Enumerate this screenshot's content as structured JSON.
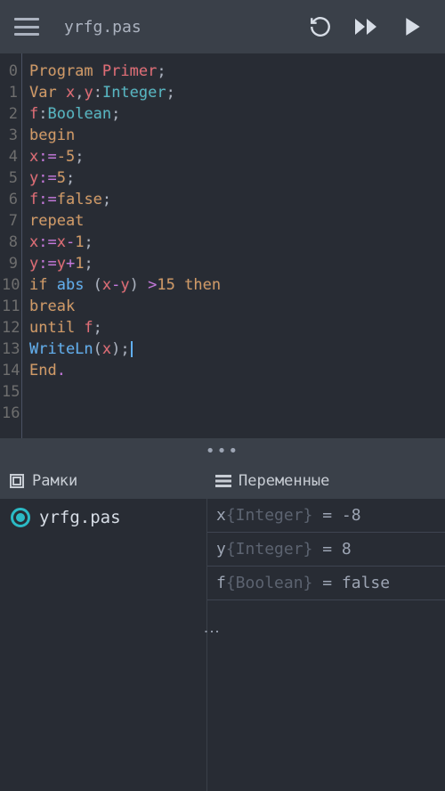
{
  "toolbar": {
    "filename": "yrfg.pas"
  },
  "code": {
    "lines": [
      {
        "n": "0",
        "tokens": [
          [
            "kw",
            "Program "
          ],
          [
            "ident",
            "Primer"
          ],
          [
            "punct",
            ";"
          ]
        ]
      },
      {
        "n": "1",
        "tokens": [
          [
            "kw",
            "Var "
          ],
          [
            "ident",
            "x"
          ],
          [
            "punct",
            ","
          ],
          [
            "ident",
            "y"
          ],
          [
            "punct",
            ":"
          ],
          [
            "type",
            "Integer"
          ],
          [
            "punct",
            ";"
          ]
        ]
      },
      {
        "n": "2",
        "tokens": [
          [
            "ident",
            "f"
          ],
          [
            "punct",
            ":"
          ],
          [
            "type",
            "Boolean"
          ],
          [
            "punct",
            ";"
          ]
        ]
      },
      {
        "n": "3",
        "tokens": [
          [
            "kw",
            "begin"
          ]
        ]
      },
      {
        "n": "4",
        "tokens": [
          [
            "ident",
            "x"
          ],
          [
            "op",
            ":="
          ],
          [
            "num",
            "-5"
          ],
          [
            "punct",
            ";"
          ]
        ]
      },
      {
        "n": "5",
        "tokens": [
          [
            "ident",
            "y"
          ],
          [
            "op",
            ":="
          ],
          [
            "num",
            "5"
          ],
          [
            "punct",
            ";"
          ]
        ]
      },
      {
        "n": "6",
        "tokens": [
          [
            "ident",
            "f"
          ],
          [
            "op",
            ":="
          ],
          [
            "num",
            "false"
          ],
          [
            "punct",
            ";"
          ]
        ]
      },
      {
        "n": "7",
        "tokens": [
          [
            "kw",
            "repeat"
          ]
        ]
      },
      {
        "n": "8",
        "tokens": [
          [
            "ident",
            "x"
          ],
          [
            "op",
            ":="
          ],
          [
            "ident",
            "x"
          ],
          [
            "op",
            "-"
          ],
          [
            "num",
            "1"
          ],
          [
            "punct",
            ";"
          ]
        ]
      },
      {
        "n": "9",
        "tokens": [
          [
            "ident",
            "y"
          ],
          [
            "op",
            ":="
          ],
          [
            "ident",
            "y"
          ],
          [
            "op",
            "+"
          ],
          [
            "num",
            "1"
          ],
          [
            "punct",
            ";"
          ]
        ]
      },
      {
        "n": "10",
        "tokens": [
          [
            "kw",
            "if "
          ],
          [
            "func",
            "abs "
          ],
          [
            "punct",
            "("
          ],
          [
            "ident",
            "x"
          ],
          [
            "op",
            "-"
          ],
          [
            "ident",
            "y"
          ],
          [
            "punct",
            ") "
          ],
          [
            "op",
            ">"
          ],
          [
            "num",
            "15 "
          ],
          [
            "kw",
            "then"
          ]
        ]
      },
      {
        "n": "11",
        "tokens": [
          [
            "kw",
            "break"
          ]
        ]
      },
      {
        "n": "12",
        "tokens": [
          [
            "kw",
            "until "
          ],
          [
            "ident",
            "f"
          ],
          [
            "punct",
            ";"
          ]
        ]
      },
      {
        "n": "13",
        "tokens": [
          [
            "func",
            "WriteLn"
          ],
          [
            "punct",
            "("
          ],
          [
            "ident",
            "x"
          ],
          [
            "punct",
            ");"
          ]
        ],
        "cursor": true
      },
      {
        "n": "14",
        "tokens": [
          [
            "kw",
            "End"
          ],
          [
            "op",
            "."
          ]
        ]
      },
      {
        "n": "15",
        "tokens": []
      },
      {
        "n": "16",
        "tokens": []
      }
    ]
  },
  "panels": {
    "frames_title": "Рамки",
    "vars_title": "Переменные",
    "frame": {
      "name": "yrfg.pas"
    },
    "variables": [
      {
        "name": "x",
        "type": "Integer",
        "value": "-8"
      },
      {
        "name": "y",
        "type": "Integer",
        "value": "8"
      },
      {
        "name": "f",
        "type": "Boolean",
        "value": "false"
      }
    ]
  }
}
